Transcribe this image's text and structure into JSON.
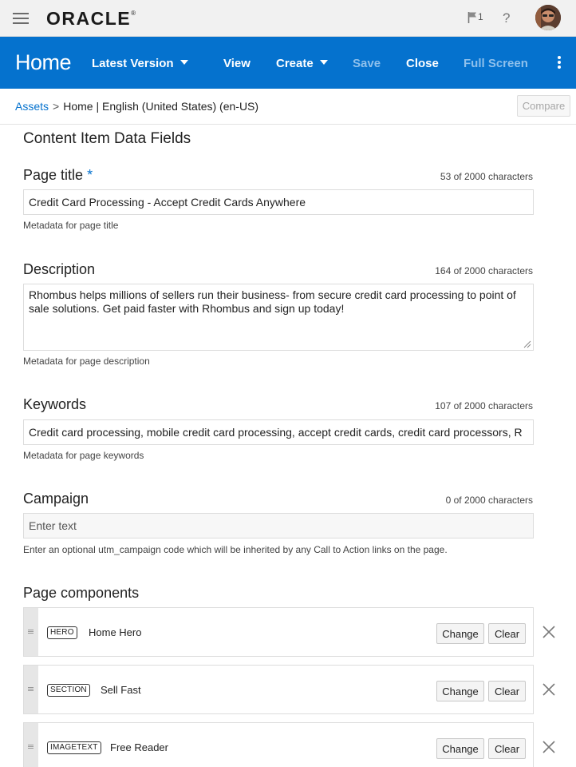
{
  "topbar": {
    "logo": "ORACLE",
    "logo_mark": "®",
    "notification_count": "1",
    "help": "?"
  },
  "toolbar": {
    "title": "Home",
    "version_label": "Latest Version",
    "view_label": "View",
    "create_label": "Create",
    "save_label": "Save",
    "close_label": "Close",
    "fullscreen_label": "Full Screen"
  },
  "breadcrumb": {
    "assets": "Assets",
    "separator": ">",
    "current": "Home",
    "divider": "|",
    "locale": "English (United States) (en-US)",
    "compare_label": "Compare"
  },
  "content": {
    "section_title": "Content Item Data Fields",
    "fields": [
      {
        "label": "Page title",
        "required_mark": "*",
        "char_count": "53 of 2000 characters",
        "value": "Credit Card Processing - Accept Credit Cards Anywhere",
        "help": "Metadata for page title"
      },
      {
        "label": "Description",
        "char_count": "164 of 2000 characters",
        "value": "Rhombus helps millions of sellers run their business- from secure credit card processing to point of sale solutions. Get paid faster with Rhombus and sign up today!",
        "help": "Metadata for page description"
      },
      {
        "label": "Keywords",
        "char_count": "107 of 2000 characters",
        "value": "Credit card processing, mobile credit card processing, accept credit cards, credit card processors, R",
        "help": "Metadata for page keywords"
      },
      {
        "label": "Campaign",
        "char_count": "0 of 2000 characters",
        "placeholder": "Enter text",
        "help": "Enter an optional utm_campaign code which will be inherited by any Call to Action links on the page."
      }
    ],
    "components_title": "Page components",
    "components": [
      {
        "badge": "HERO",
        "name": "Home Hero",
        "change_label": "Change",
        "clear_label": "Clear"
      },
      {
        "badge": "SECTION",
        "name": "Sell Fast",
        "change_label": "Change",
        "clear_label": "Clear"
      },
      {
        "badge": "IMAGETEXT",
        "name": "Free Reader",
        "change_label": "Change",
        "clear_label": "Clear"
      }
    ]
  },
  "colors": {
    "toolbar_blue": "#0572ce",
    "topbar_bg": "#f1f1f1",
    "disabled_text": "#8ec0ec"
  }
}
